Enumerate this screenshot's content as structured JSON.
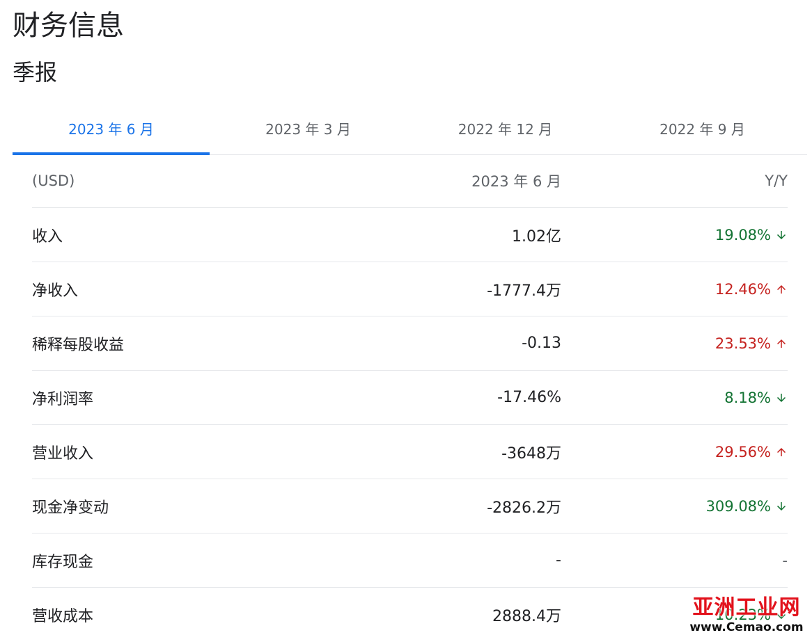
{
  "page": {
    "title": "财务信息",
    "section": "季报"
  },
  "tabs": [
    {
      "label": "2023 年 6 月",
      "active": true
    },
    {
      "label": "2023 年 3 月",
      "active": false
    },
    {
      "label": "2022 年 12 月",
      "active": false
    },
    {
      "label": "2022 年 9 月",
      "active": false
    }
  ],
  "table": {
    "header": {
      "label": "(USD)",
      "value": "2023 年 6 月",
      "yy": "Y/Y"
    },
    "rows": [
      {
        "label": "收入",
        "value": "1.02亿",
        "yy": "19.08%",
        "direction": "down"
      },
      {
        "label": "净收入",
        "value": "-1777.4万",
        "yy": "12.46%",
        "direction": "up"
      },
      {
        "label": "稀释每股收益",
        "value": "-0.13",
        "yy": "23.53%",
        "direction": "up"
      },
      {
        "label": "净利润率",
        "value": "-17.46%",
        "yy": "8.18%",
        "direction": "down"
      },
      {
        "label": "营业收入",
        "value": "-3648万",
        "yy": "29.56%",
        "direction": "up"
      },
      {
        "label": "现金净变动",
        "value": "-2826.2万",
        "yy": "309.08%",
        "direction": "down"
      },
      {
        "label": "库存现金",
        "value": "-",
        "yy": "-",
        "direction": "none"
      },
      {
        "label": "营收成本",
        "value": "2888.4万",
        "yy": "10.23%",
        "direction": "down"
      }
    ]
  },
  "colors": {
    "accent": "#1a73e8",
    "positive": "#137333",
    "negative": "#c5221f"
  },
  "icons": {
    "up": "arrow-up-icon",
    "down": "arrow-down-icon"
  },
  "watermark": {
    "main": "亚洲工业网",
    "sub": "www.Cemao.com"
  }
}
